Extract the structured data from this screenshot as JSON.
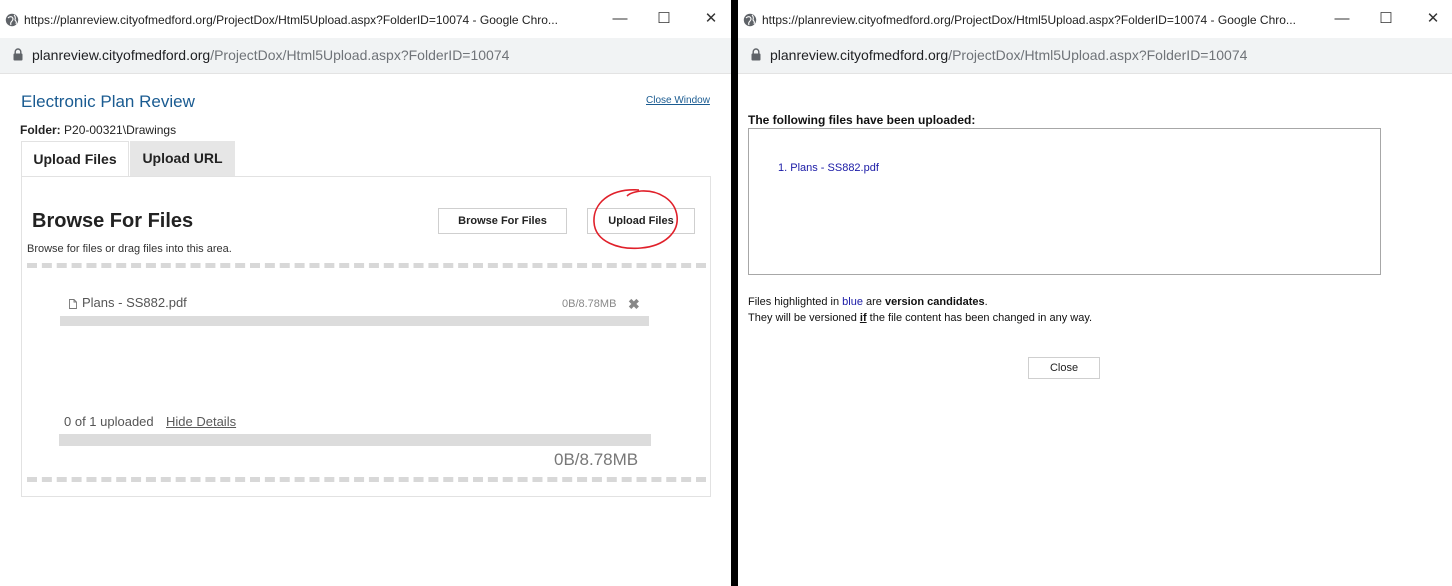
{
  "left_window": {
    "title": "https://planreview.cityofmedford.org/ProjectDox/Html5Upload.aspx?FolderID=10074 - Google Chro...",
    "url_domain": "planreview.cityofmedford.org",
    "url_path": "/ProjectDox/Html5Upload.aspx?FolderID=10074",
    "controls": {
      "minimize": "—",
      "maximize": "☐",
      "close": "✕"
    },
    "app_title": "Electronic Plan Review",
    "close_window_label": "Close Window",
    "folder_label": "Folder:",
    "folder_value": "P20-00321\\Drawings",
    "tabs": [
      {
        "label": "Upload Files",
        "active": true
      },
      {
        "label": "Upload URL",
        "active": false
      }
    ],
    "browse_heading": "Browse For Files",
    "browse_button_label": "Browse For Files",
    "upload_button_label": "Upload Files",
    "browse_hint": "Browse for files or drag files into this area.",
    "files": [
      {
        "name": "Plans - SS882.pdf",
        "size": "0B/8.78MB",
        "progress": 0
      }
    ],
    "uploaded_count": "0 of 1 uploaded",
    "hide_details_label": "Hide Details",
    "total_size": "0B/8.78MB",
    "total_progress": 0,
    "annotation_color": "#e0202a"
  },
  "right_window": {
    "title": "https://planreview.cityofmedford.org/ProjectDox/Html5Upload.aspx?FolderID=10074 - Google Chro...",
    "url_domain": "planreview.cityofmedford.org",
    "url_path": "/ProjectDox/Html5Upload.aspx?FolderID=10074",
    "controls": {
      "minimize": "—",
      "maximize": "☐",
      "close": "✕"
    },
    "uploaded_heading": "The following files have been uploaded:",
    "uploaded_files": [
      "1. Plans - SS882.pdf"
    ],
    "note_line1_pre": "Files highlighted in ",
    "note_line1_blue": "blue",
    "note_line1_mid": " are ",
    "note_line1_bold": "version candidates",
    "note_line1_end": ".",
    "note_line2_pre": "They will be versioned ",
    "note_line2_if": "if",
    "note_line2_post": " the file content has been changed in any way.",
    "close_button_label": "Close"
  }
}
